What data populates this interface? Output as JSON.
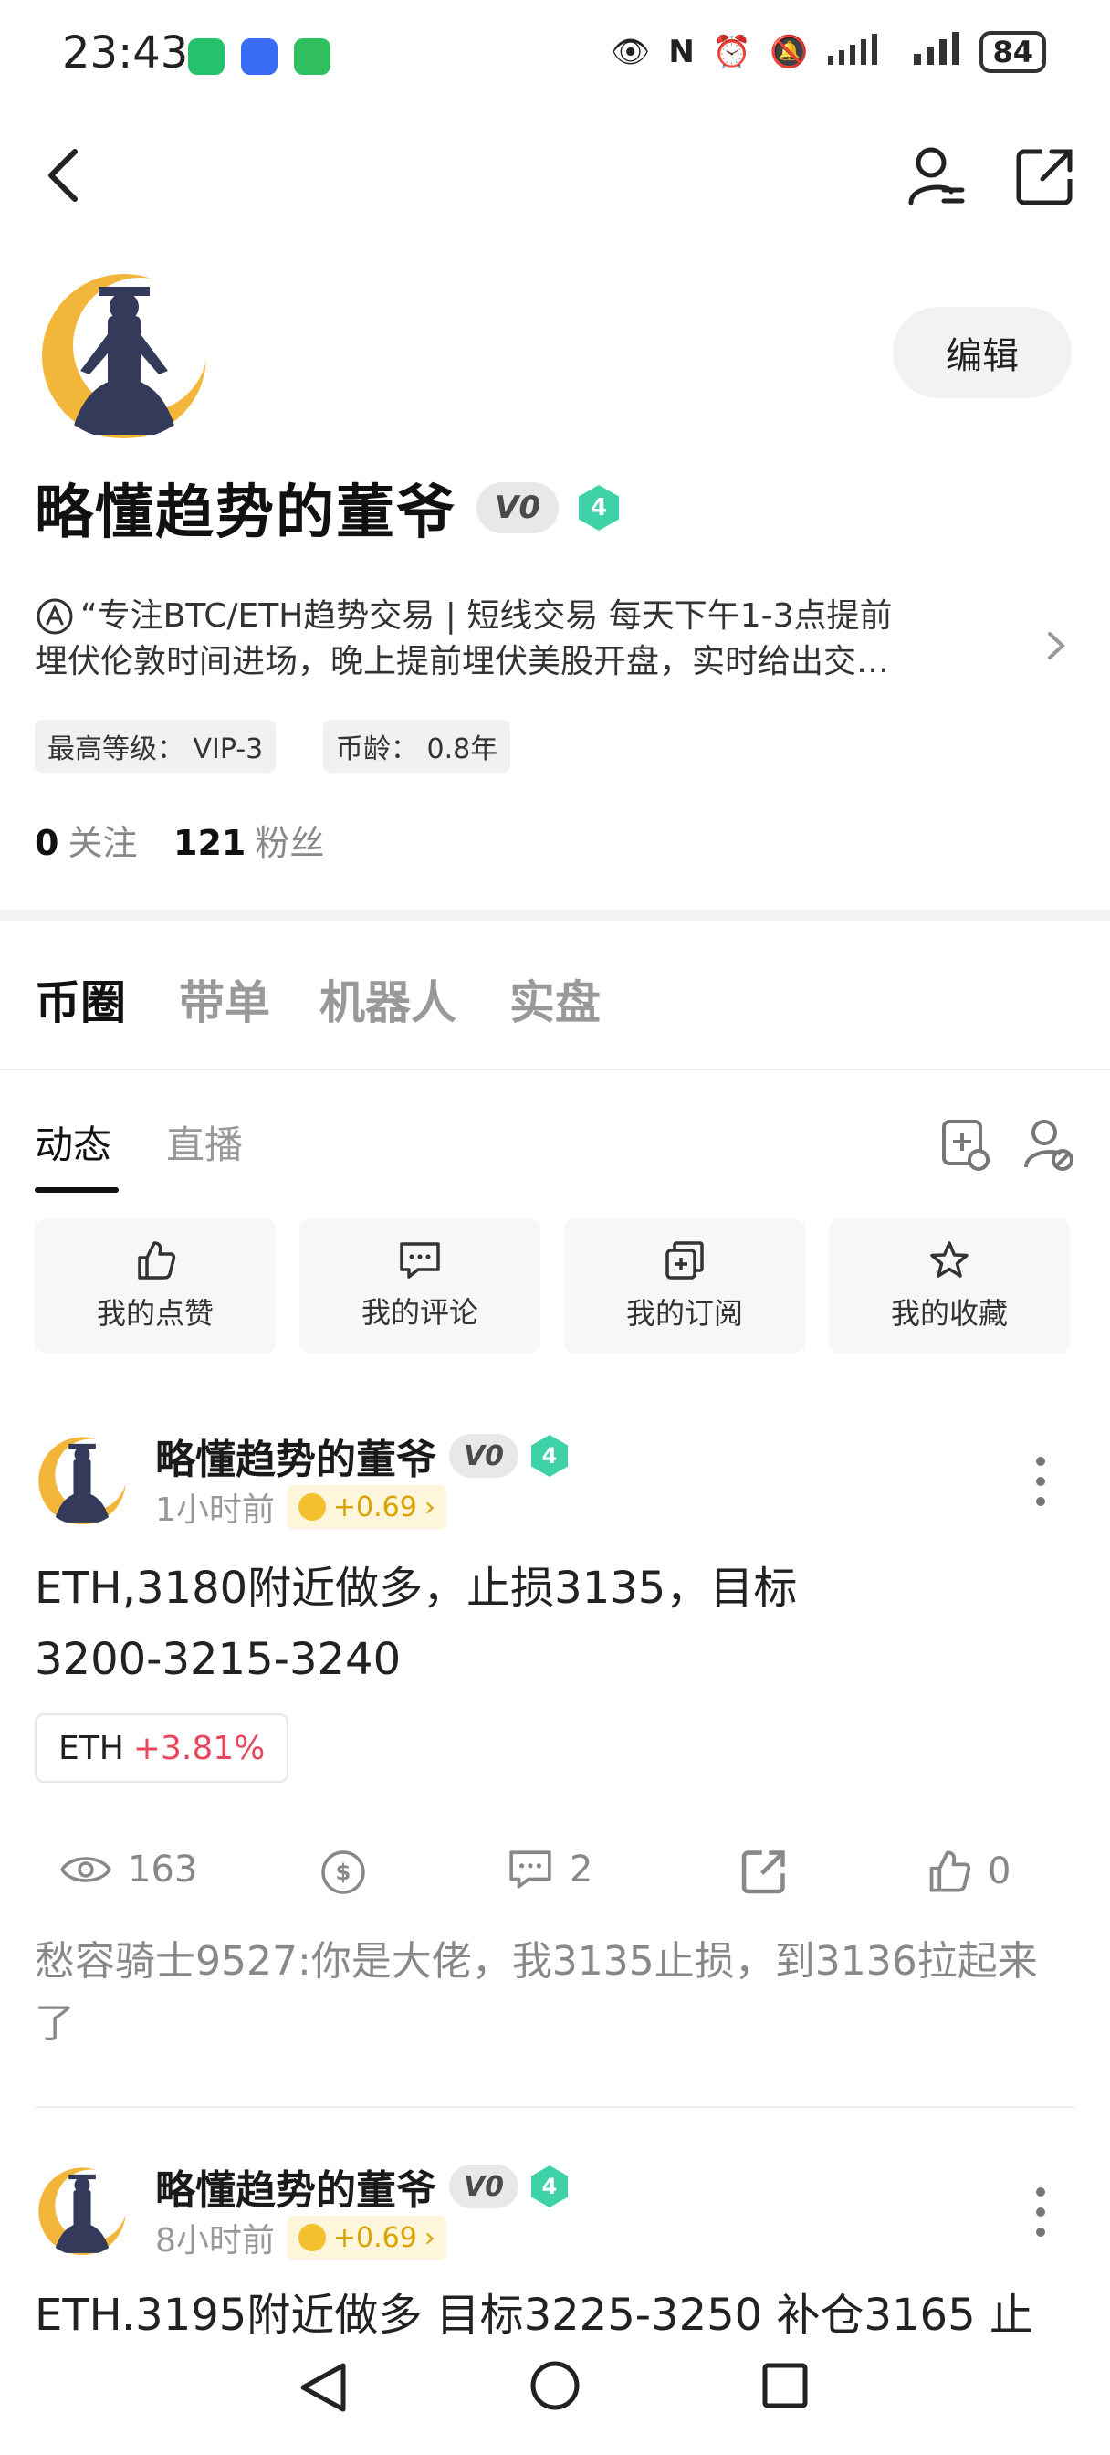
{
  "status_bar": {
    "time": "23:43",
    "battery": "84"
  },
  "profile": {
    "edit_label": "编辑",
    "username": "略懂趋势的董爷",
    "v_badge": "V0",
    "level": "4",
    "bio_line1": "“专注BTC/ETH趋势交易 | 短线交易 每天下午1-3点提前",
    "bio_line2": "埋伏伦敦时间进场，晚上提前埋伏美股开盘，实时给出交…",
    "tags": [
      "最高等级：  VIP-3",
      "币龄：  0.8年"
    ],
    "following_count": "0",
    "following_label": "关注",
    "followers_count": "121",
    "followers_label": "粉丝"
  },
  "main_tabs": [
    "币圈",
    "带单",
    "机器人",
    "实盘"
  ],
  "sub_tabs": [
    "动态",
    "直播"
  ],
  "quick_actions": [
    "我的点赞",
    "我的评论",
    "我的订阅",
    "我的收藏"
  ],
  "posts": [
    {
      "user": "略懂趋势的董爷",
      "v_badge": "V0",
      "level": "4",
      "time": "1小时前",
      "coin": "+0.69",
      "text_line1": "ETH,3180附近做多，止损3135，目标",
      "text_line2": "3200-3215-3240",
      "token": "ETH",
      "token_change": "+3.81%",
      "views": "163",
      "comments": "2",
      "likes": "0",
      "top_comment_line1": "愁容骑士9527:你是大佬，我3135止损，到3136拉起来",
      "top_comment_line2": "了"
    },
    {
      "user": "略懂趋势的董爷",
      "v_badge": "V0",
      "level": "4",
      "time": "8小时前",
      "coin": "+0.69",
      "text_line1": "ETH.3195附近做多 目标3225-3250 补仓3165 止"
    }
  ],
  "colors": {
    "accent_green": "#3fd1a7",
    "price_up_red": "#e8465c",
    "coin_gold": "#d9a300"
  }
}
